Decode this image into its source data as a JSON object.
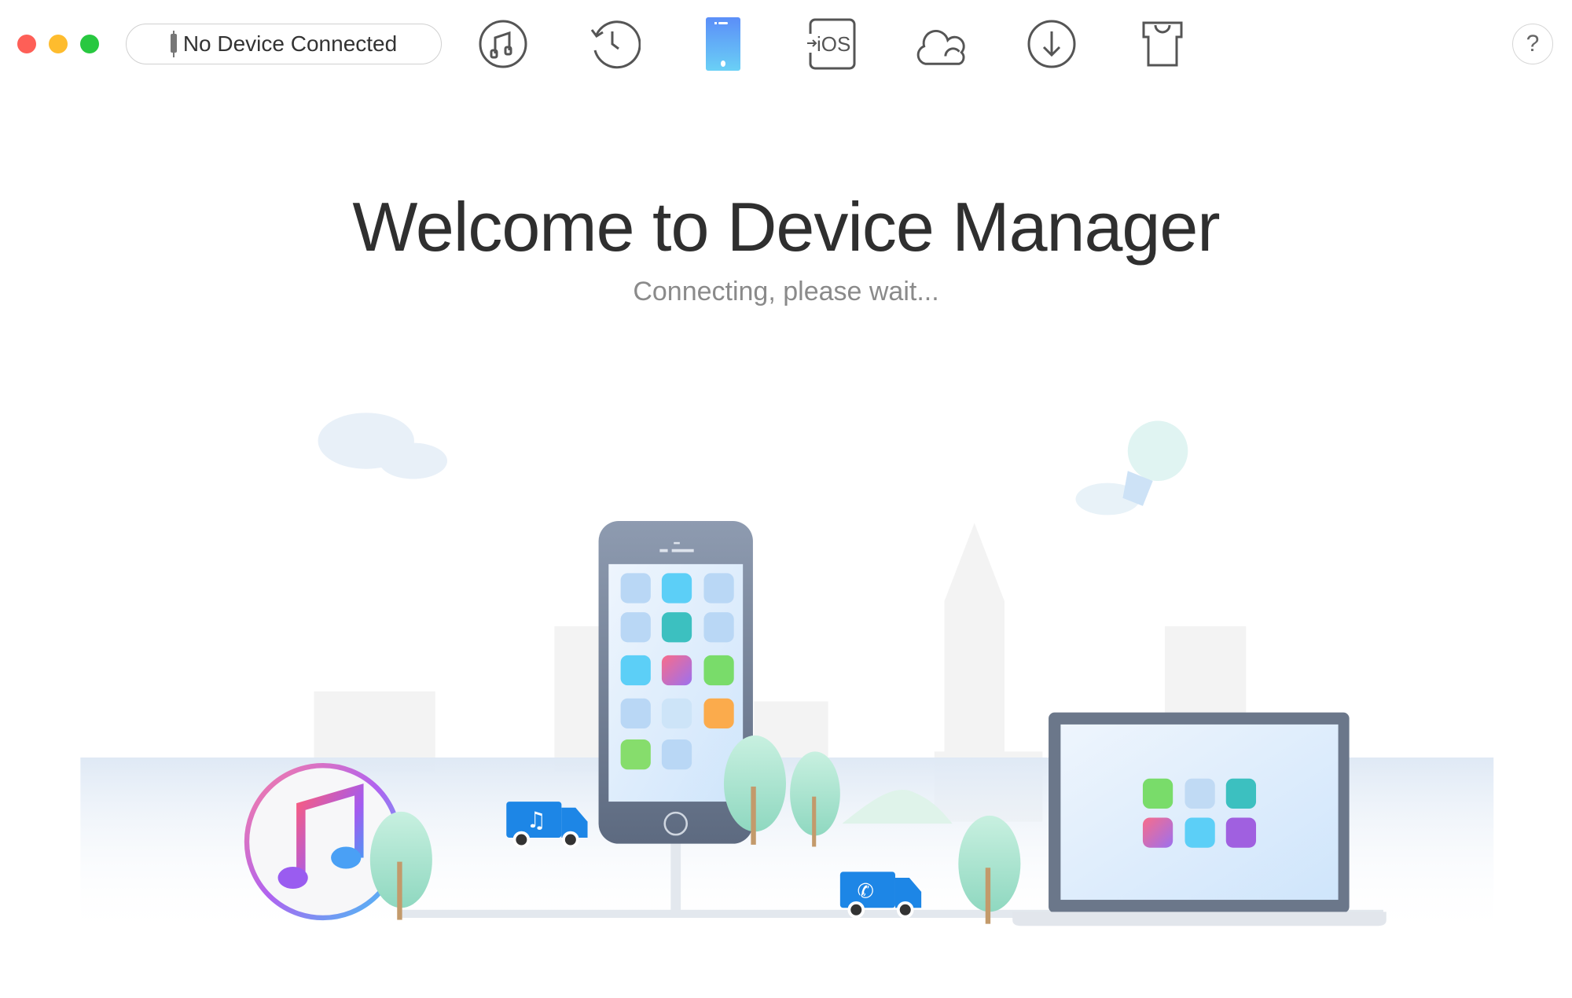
{
  "window": {
    "controls": [
      {
        "name": "close",
        "color": "#fe5f57"
      },
      {
        "name": "minimize",
        "color": "#febc2e"
      },
      {
        "name": "zoom",
        "color": "#28c840"
      }
    ]
  },
  "toolbar": {
    "device_status": "No Device Connected",
    "items": [
      {
        "name": "music-icon",
        "active": false
      },
      {
        "name": "history-icon",
        "active": false
      },
      {
        "name": "device-icon",
        "active": true
      },
      {
        "name": "ios-mover-icon",
        "label": "iOS",
        "active": false
      },
      {
        "name": "cloud-icon",
        "active": false
      },
      {
        "name": "download-icon",
        "active": false
      },
      {
        "name": "shirt-icon",
        "active": false
      }
    ],
    "help_label": "?",
    "icon_color": "#555555",
    "active_color": "#5b9bf8"
  },
  "main": {
    "title": "Welcome to Device Manager",
    "subtitle": "Connecting, please wait..."
  }
}
